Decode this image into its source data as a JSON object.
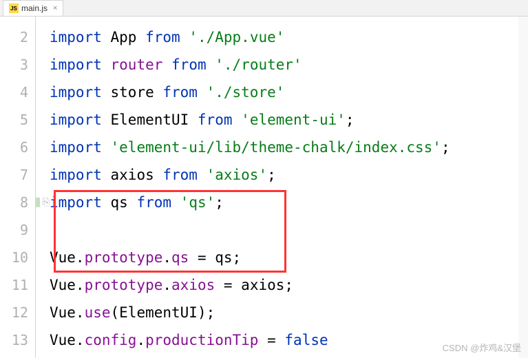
{
  "tab": {
    "filename": "main.js",
    "icon_label": "JS"
  },
  "code": {
    "lines": [
      {
        "num": "2",
        "tokens": [
          {
            "t": "import ",
            "c": "kw"
          },
          {
            "t": "App ",
            "c": "ident"
          },
          {
            "t": "from ",
            "c": "kw"
          },
          {
            "t": "'./App.vue'",
            "c": "str"
          }
        ]
      },
      {
        "num": "3",
        "tokens": [
          {
            "t": "import ",
            "c": "kw"
          },
          {
            "t": "router ",
            "c": "prop"
          },
          {
            "t": "from ",
            "c": "kw"
          },
          {
            "t": "'./router'",
            "c": "str"
          }
        ]
      },
      {
        "num": "4",
        "tokens": [
          {
            "t": "import ",
            "c": "kw"
          },
          {
            "t": "store ",
            "c": "ident"
          },
          {
            "t": "from ",
            "c": "kw"
          },
          {
            "t": "'./store'",
            "c": "str"
          }
        ]
      },
      {
        "num": "5",
        "tokens": [
          {
            "t": "import ",
            "c": "kw"
          },
          {
            "t": "ElementUI ",
            "c": "ident"
          },
          {
            "t": "from ",
            "c": "kw"
          },
          {
            "t": "'element-ui'",
            "c": "str"
          },
          {
            "t": ";",
            "c": "ident"
          }
        ]
      },
      {
        "num": "6",
        "tokens": [
          {
            "t": "import ",
            "c": "kw"
          },
          {
            "t": "'element-ui/lib/theme-chalk/index.css'",
            "c": "str"
          },
          {
            "t": ";",
            "c": "ident"
          }
        ]
      },
      {
        "num": "7",
        "tokens": [
          {
            "t": "import ",
            "c": "kw"
          },
          {
            "t": "axios ",
            "c": "ident"
          },
          {
            "t": "from ",
            "c": "kw"
          },
          {
            "t": "'axios'",
            "c": "str"
          },
          {
            "t": ";",
            "c": "ident"
          }
        ]
      },
      {
        "num": "8",
        "tokens": [
          {
            "t": "import ",
            "c": "kw"
          },
          {
            "t": "qs ",
            "c": "ident"
          },
          {
            "t": "from ",
            "c": "kw"
          },
          {
            "t": "'qs'",
            "c": "str"
          },
          {
            "t": ";",
            "c": "ident"
          }
        ]
      },
      {
        "num": "9",
        "tokens": []
      },
      {
        "num": "10",
        "tokens": [
          {
            "t": "Vue.",
            "c": "ident"
          },
          {
            "t": "prototype",
            "c": "prop"
          },
          {
            "t": ".",
            "c": "ident"
          },
          {
            "t": "qs",
            "c": "prop"
          },
          {
            "t": " = qs;",
            "c": "ident"
          }
        ]
      },
      {
        "num": "11",
        "tokens": [
          {
            "t": "Vue.",
            "c": "ident"
          },
          {
            "t": "prototype",
            "c": "prop"
          },
          {
            "t": ".",
            "c": "ident"
          },
          {
            "t": "axios",
            "c": "prop"
          },
          {
            "t": " = axios;",
            "c": "ident"
          }
        ]
      },
      {
        "num": "12",
        "tokens": [
          {
            "t": "Vue.",
            "c": "ident"
          },
          {
            "t": "use",
            "c": "prop"
          },
          {
            "t": "(ElementUI);",
            "c": "ident"
          }
        ]
      },
      {
        "num": "13",
        "tokens": [
          {
            "t": "Vue.",
            "c": "ident"
          },
          {
            "t": "config",
            "c": "prop"
          },
          {
            "t": ".",
            "c": "ident"
          },
          {
            "t": "productionTip",
            "c": "prop"
          },
          {
            "t": " = ",
            "c": "ident"
          },
          {
            "t": "false",
            "c": "kw"
          }
        ]
      }
    ]
  },
  "watermark": "CSDN @炸鸡&汉堡"
}
